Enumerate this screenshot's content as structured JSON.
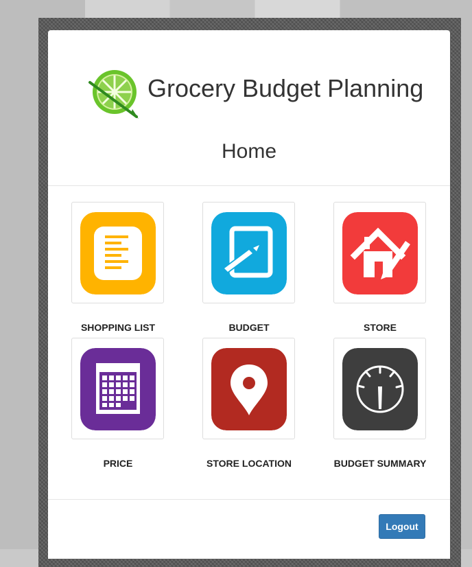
{
  "app": {
    "title": "Grocery Budget Planning",
    "logo_icon": "lime-slice-icon"
  },
  "page": {
    "title": "Home"
  },
  "tiles": [
    {
      "label": "SHOPPING LIST",
      "icon": "shopping-list-icon",
      "color": "#ffb300"
    },
    {
      "label": "BUDGET",
      "icon": "budget-icon",
      "color": "#11a9dd"
    },
    {
      "label": "STORE",
      "icon": "store-icon",
      "color": "#f23b3b"
    },
    {
      "label": "PRICE",
      "icon": "calendar-icon",
      "color": "#6a2d98"
    },
    {
      "label": "STORE LOCATION",
      "icon": "location-pin-icon",
      "color": "#b22a21"
    },
    {
      "label": "BUDGET SUMMARY",
      "icon": "gauge-icon",
      "color": "#3e3e3e"
    }
  ],
  "actions": {
    "logout_label": "Logout",
    "logout_color": "#337ab7"
  }
}
